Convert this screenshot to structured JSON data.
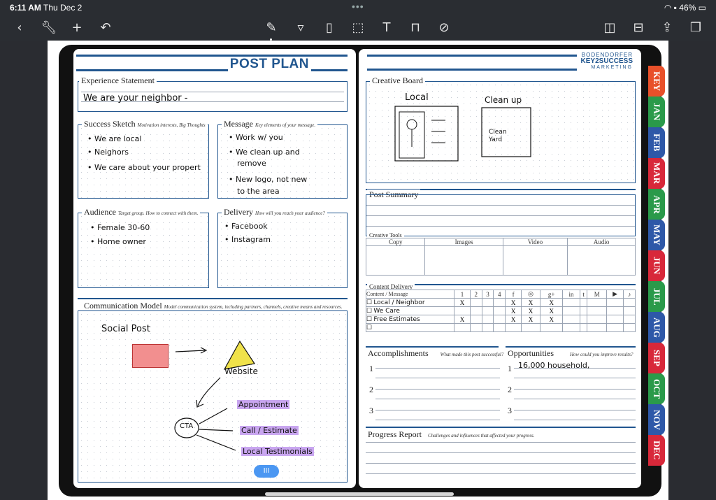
{
  "status": {
    "time": "6:11 AM",
    "date": "Thu Dec 2",
    "battery": "46%"
  },
  "toolbar": {
    "left_icons": [
      "back-icon",
      "wrench-icon",
      "plus-icon",
      "undo-icon"
    ],
    "center_icons": [
      "pen-icon",
      "highlighter-icon",
      "eraser-icon",
      "lasso-icon",
      "text-icon",
      "presentation-icon",
      "no-touch-icon"
    ],
    "right_icons": [
      "shapes-icon",
      "stamp-icon",
      "share-icon",
      "pages-icon"
    ]
  },
  "left_page": {
    "title": "POST PLAN",
    "experience": {
      "label": "Experience Statement",
      "text": "We are your neighbor -"
    },
    "success": {
      "label": "Success Sketch",
      "hint": "Motivation interests, Big Thoughts",
      "items": [
        "• We are local",
        "• Neighors",
        "• We care about your propert"
      ]
    },
    "message": {
      "label": "Message",
      "hint": "Key elements of your message.",
      "items": [
        "• Work w/ you",
        "• We clean up and",
        "remove",
        "• New logo, not new",
        "to the area"
      ]
    },
    "audience": {
      "label": "Audience",
      "hint": "Target group. How to connect with them.",
      "items": [
        "• Female 30-60",
        "• Home owner"
      ]
    },
    "delivery": {
      "label": "Delivery",
      "hint": "How will you reach your audience?",
      "items": [
        "• Facebook",
        "• Instagram"
      ]
    },
    "comm": {
      "label": "Communication Model",
      "hint": "Model communication system, including partners, channels, creative means and resources.",
      "social": "Social Post",
      "website": "Website",
      "cta": "CTA",
      "appointment": "Appointment",
      "call": "Call / Estimate",
      "testimonial": "Local Testimonials"
    }
  },
  "right_page": {
    "brand": {
      "line1": "BODENDORFER",
      "line2": "KEY2SUCCESS",
      "line3": "MARKETING"
    },
    "creative_board": {
      "label": "Creative Board",
      "sketch1": "Local",
      "sketch2": "Clean up",
      "sketch2_inner": "Clean Yard"
    },
    "post_summary": {
      "label": "Post Summary"
    },
    "creative_tools": {
      "label": "Creative Tools",
      "columns": [
        "Copy",
        "Images",
        "Video",
        "Audio"
      ]
    },
    "content_delivery": {
      "label": "Content Delivery",
      "header_label": "Content / Message",
      "numbers": [
        "1",
        "2",
        "3",
        "4"
      ],
      "social_icons": [
        "facebook-icon",
        "instagram-icon",
        "google-plus-icon",
        "linkedin-icon",
        "twitter-icon",
        "medium-icon",
        "youtube-icon",
        "tiktok-icon"
      ],
      "social_glyphs": [
        "f",
        "◎",
        "g+",
        "in",
        "t",
        "M",
        "▶",
        "♪"
      ],
      "rows": [
        {
          "name": "Local / Neighbor",
          "marks": [
            "X",
            "",
            "",
            "",
            "X",
            "X",
            "X",
            "",
            "",
            "",
            "",
            ""
          ]
        },
        {
          "name": "We Care",
          "marks": [
            "",
            "",
            "",
            "",
            "X",
            "X",
            "X",
            "",
            "",
            "",
            "",
            ""
          ]
        },
        {
          "name": "Free Estimates",
          "marks": [
            "X",
            "",
            "",
            "",
            "X",
            "X",
            "X",
            "",
            "",
            "",
            "",
            ""
          ]
        },
        {
          "name": "",
          "marks": [
            "",
            "",
            "",
            "",
            "",
            "",
            "",
            "",
            "",
            "",
            "",
            ""
          ]
        }
      ]
    },
    "accomplishments": {
      "label": "Accomplishments",
      "hint": "What made this post successful?",
      "nums": [
        "1",
        "2",
        "3"
      ]
    },
    "opportunities": {
      "label": "Opportunities",
      "hint": "How could you improve results?",
      "nums": [
        "1",
        "2",
        "3"
      ],
      "item1": "16,000 household,"
    },
    "progress": {
      "label": "Progress Report",
      "hint": "Challenges and influences that affected your progress."
    }
  },
  "tabs": [
    {
      "label": "KEY",
      "color": "#e8502a"
    },
    {
      "label": "JAN",
      "color": "#2a9a4a"
    },
    {
      "label": "FEB",
      "color": "#2e58a8"
    },
    {
      "label": "MAR",
      "color": "#d8283a"
    },
    {
      "label": "APR",
      "color": "#2a9a4a"
    },
    {
      "label": "MAY",
      "color": "#2e58a8"
    },
    {
      "label": "JUN",
      "color": "#d8283a"
    },
    {
      "label": "JUL",
      "color": "#2a9a4a"
    },
    {
      "label": "AUG",
      "color": "#2e58a8"
    },
    {
      "label": "SEP",
      "color": "#d8283a"
    },
    {
      "label": "OCT",
      "color": "#2a9a4a"
    },
    {
      "label": "NOV",
      "color": "#2e58a8"
    },
    {
      "label": "DEC",
      "color": "#d8283a"
    }
  ],
  "scroll_handle": "III"
}
